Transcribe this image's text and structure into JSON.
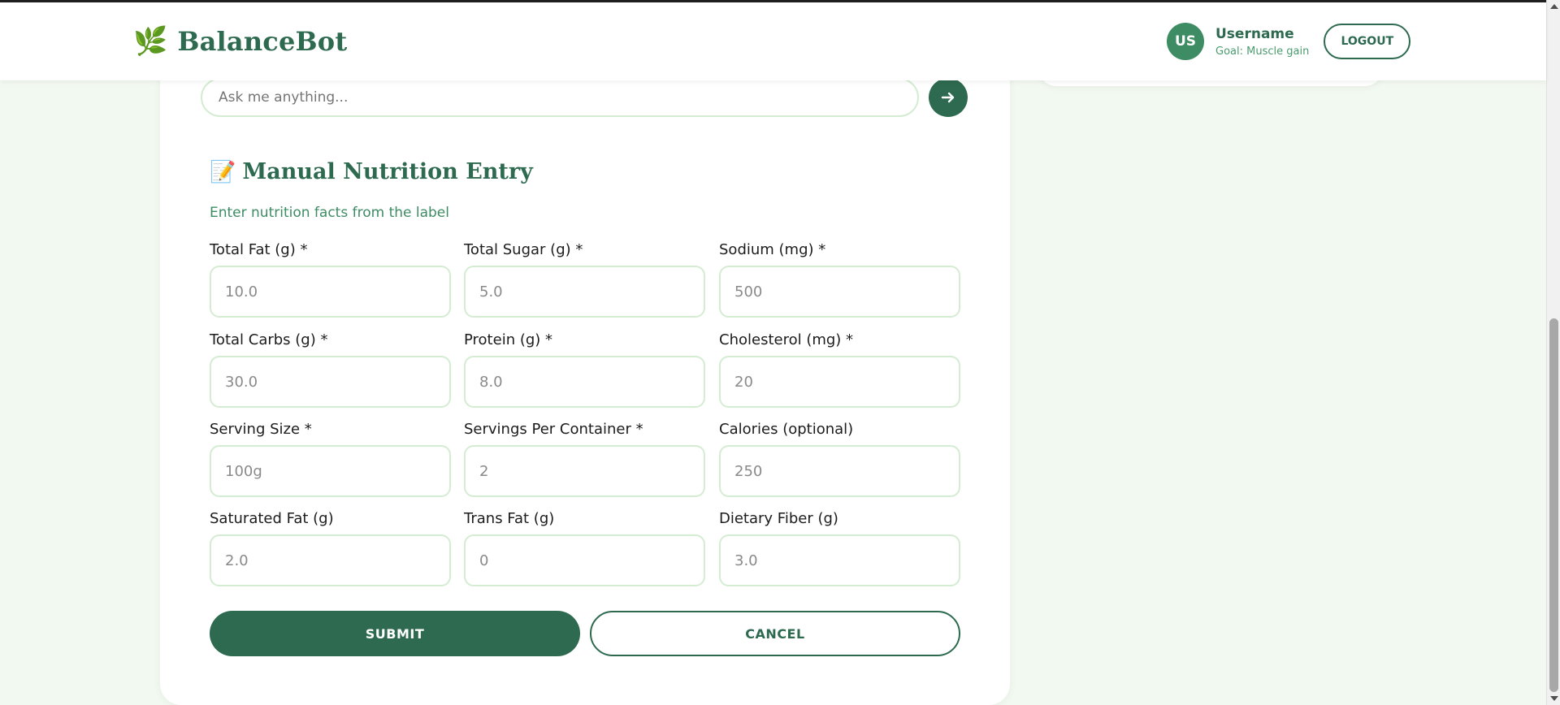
{
  "header": {
    "brand_icon": "🌿",
    "brand_name": "BalanceBot",
    "user": {
      "initials": "US",
      "name": "Username",
      "goal": "Goal: Muscle gain"
    },
    "logout_label": "LOGOUT"
  },
  "chat": {
    "placeholder": "Ask me anything...",
    "send_icon": "send-arrow-icon"
  },
  "manual_entry": {
    "title_icon": "📝",
    "title": "Manual Nutrition Entry",
    "subtitle": "Enter nutrition facts from the label",
    "fields": [
      {
        "label": "Total Fat (g) *",
        "placeholder": "10.0"
      },
      {
        "label": "Total Sugar (g) *",
        "placeholder": "5.0"
      },
      {
        "label": "Sodium (mg) *",
        "placeholder": "500"
      },
      {
        "label": "Total Carbs (g) *",
        "placeholder": "30.0"
      },
      {
        "label": "Protein (g) *",
        "placeholder": "8.0"
      },
      {
        "label": "Cholesterol (mg) *",
        "placeholder": "20"
      },
      {
        "label": "Serving Size *",
        "placeholder": "100g"
      },
      {
        "label": "Servings Per Container *",
        "placeholder": "2"
      },
      {
        "label": "Calories (optional)",
        "placeholder": "250"
      },
      {
        "label": "Saturated Fat (g)",
        "placeholder": "2.0"
      },
      {
        "label": "Trans Fat (g)",
        "placeholder": "0"
      },
      {
        "label": "Dietary Fiber (g)",
        "placeholder": "3.0"
      }
    ],
    "submit_label": "SUBMIT",
    "cancel_label": "CANCEL"
  },
  "colors": {
    "primary": "#2d6a4f",
    "accent": "#3d8c63",
    "background": "#f2f9f1",
    "input_border": "#d4ecd2"
  }
}
